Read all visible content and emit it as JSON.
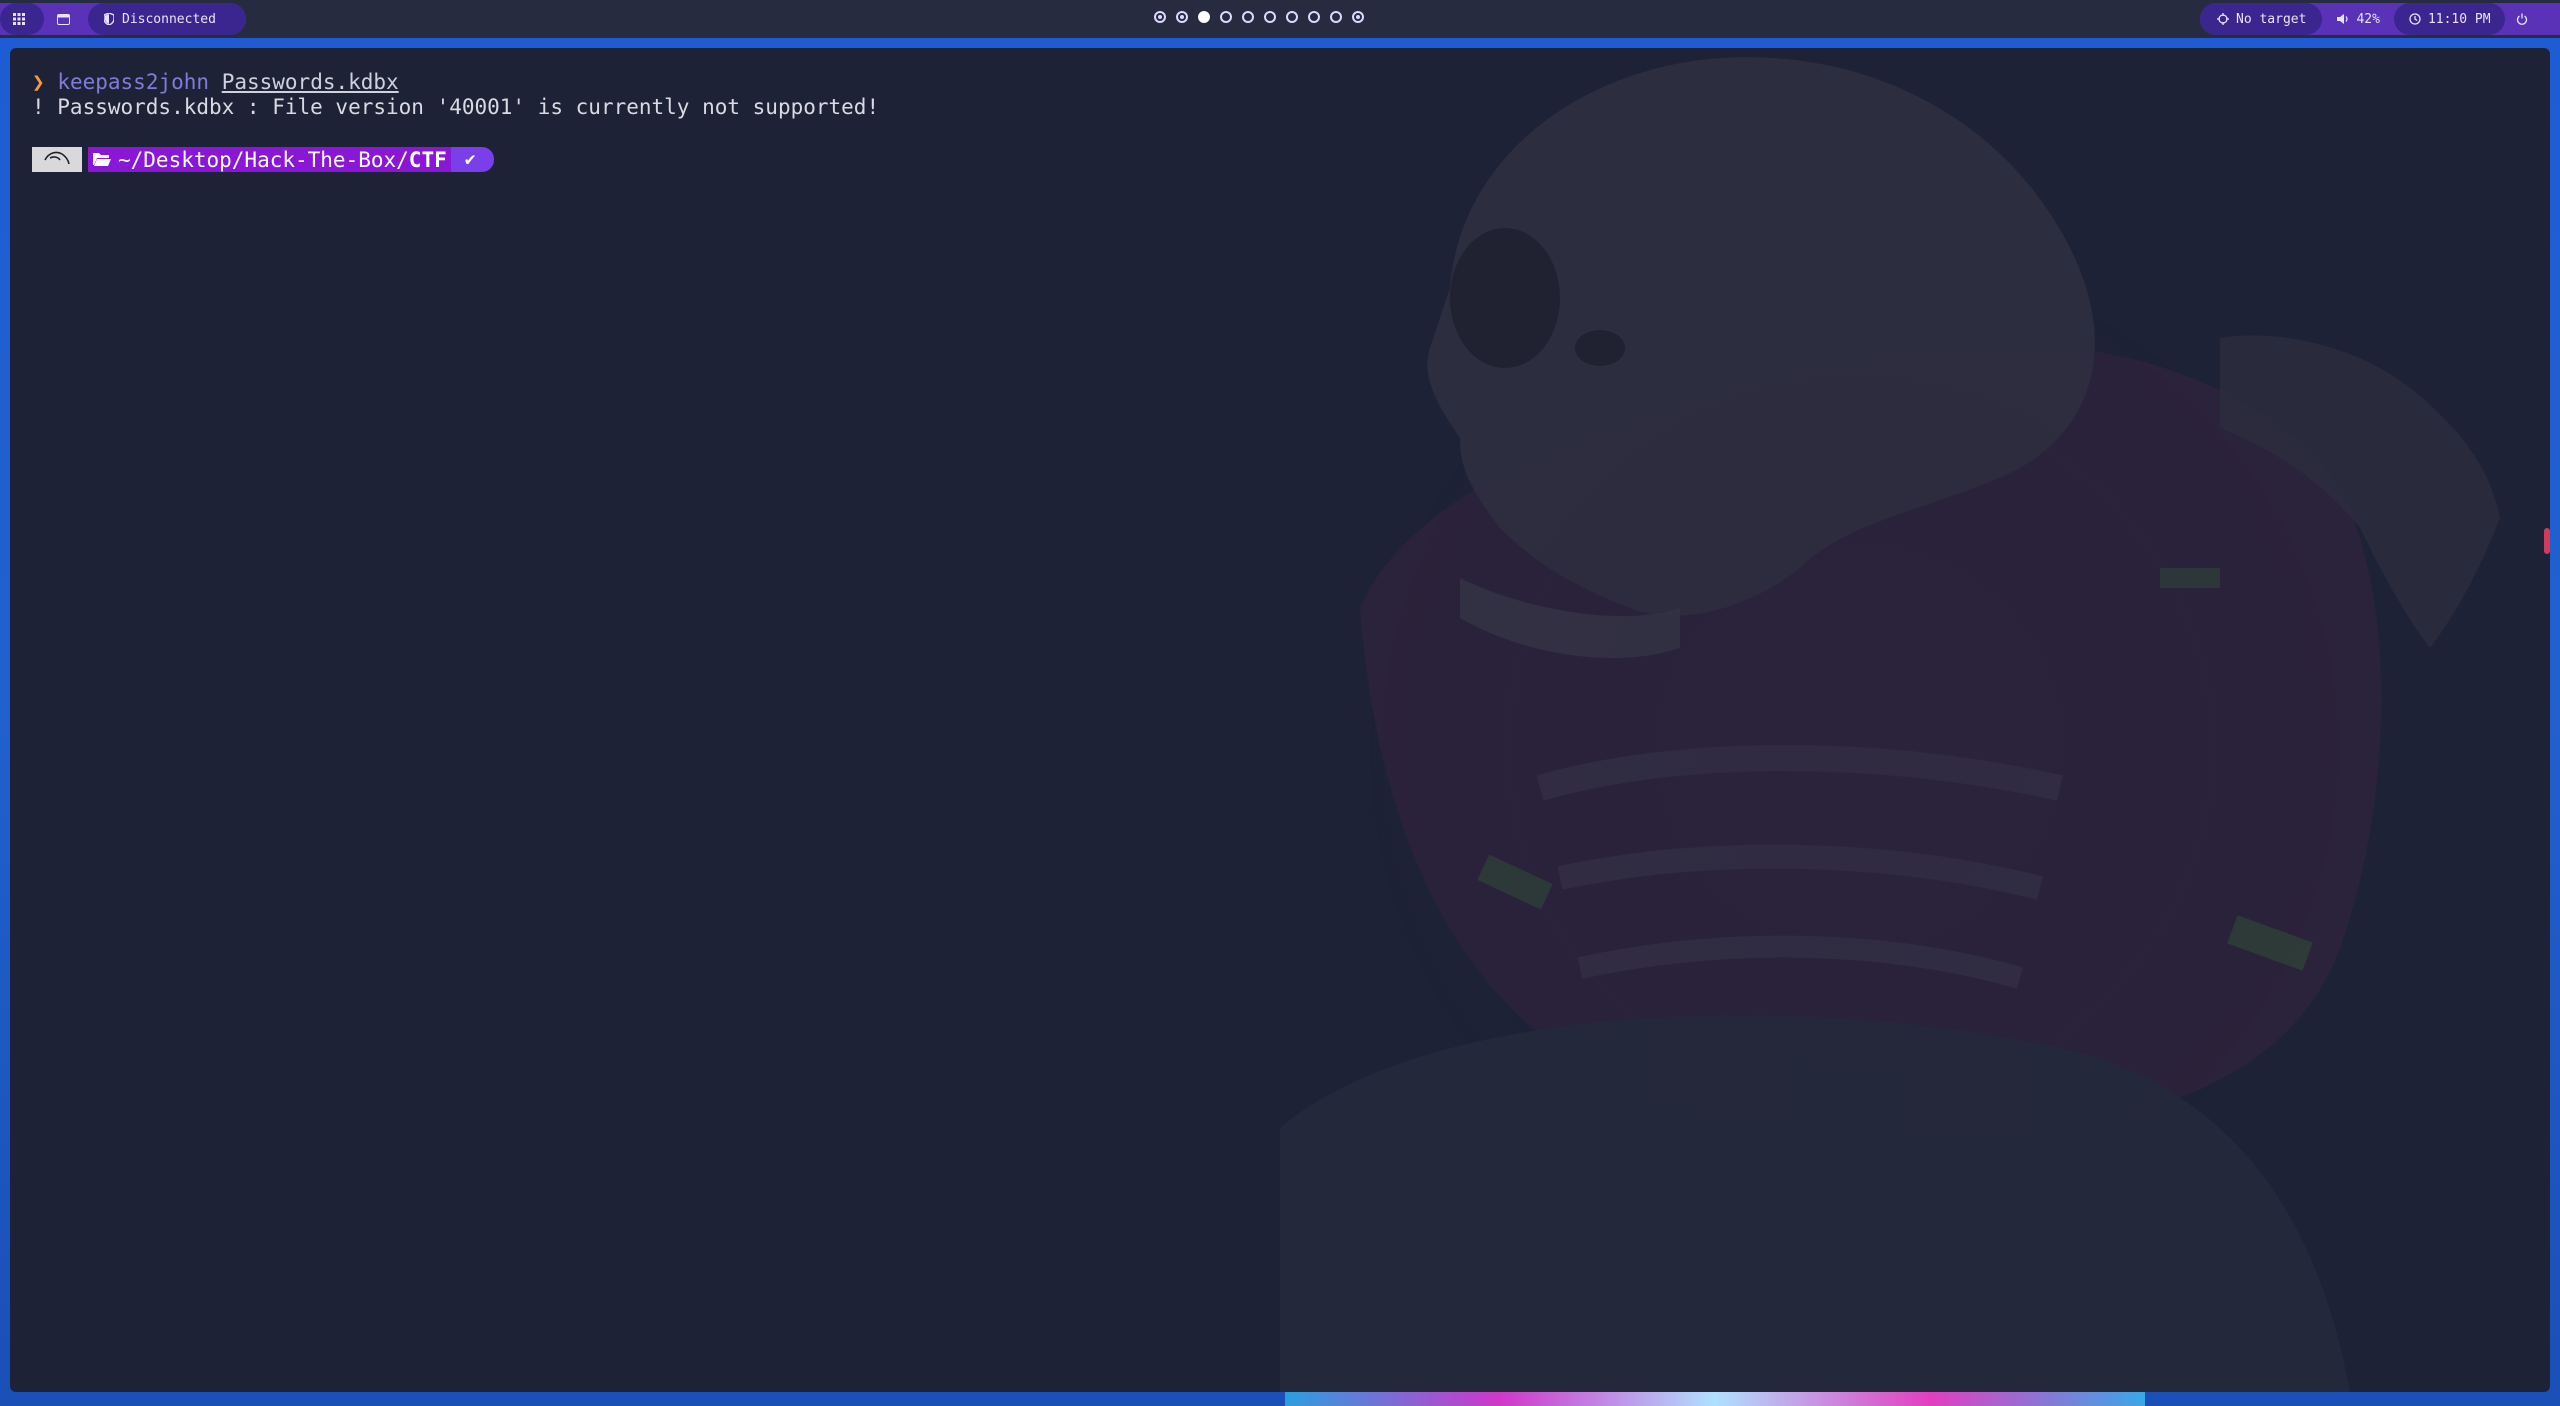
{
  "topbar": {
    "left": {
      "launcher_icon": "grid-icon",
      "window_icon": "window-icon",
      "vpn_icon": "shield-icon",
      "vpn_status": "Disconnected"
    },
    "workspaces": {
      "count": 10,
      "active_index": 2
    },
    "right": {
      "target_icon": "crosshair-icon",
      "target_label": "No target",
      "volume_icon": "speaker-icon",
      "volume": "42%",
      "clock_icon": "clock-icon",
      "time": "11:10 PM",
      "power_icon": "power-icon"
    }
  },
  "terminal": {
    "lines": [
      {
        "arrow": "❯",
        "command": "keepass2john",
        "argument": "Passwords.kdbx"
      },
      {
        "text": "! Passwords.kdbx : File version '40001' is currently not supported!"
      }
    ],
    "prompt": {
      "os_icon": "kali-dragon-icon",
      "folder_icon": "folder-open-icon",
      "path": "~/Desktop/Hack-The-Box/",
      "path_last": "CTF",
      "status": "✔"
    }
  }
}
